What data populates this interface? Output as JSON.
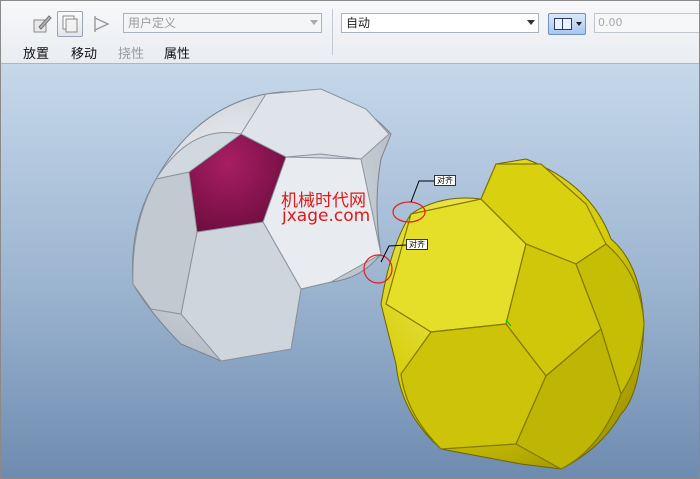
{
  "toolbar": {
    "icons": [
      "sketch-edit-icon",
      "copy-icon",
      "dimension-icon"
    ],
    "user_defined_value": "用户定义",
    "constraint_value": "自动",
    "numeric_value": "0.00",
    "view_button_icon": "split-panel-icon"
  },
  "menu": {
    "items": [
      {
        "label": "放置",
        "enabled": true
      },
      {
        "label": "移动",
        "enabled": true
      },
      {
        "label": "挠性",
        "enabled": false
      },
      {
        "label": "属性",
        "enabled": true
      }
    ]
  },
  "viewport": {
    "watermark_cn": "机械时代网",
    "watermark_url": "jxage.com",
    "tags": [
      "对齐",
      "对齐"
    ],
    "colors": {
      "white_patch": "#dfe4ea",
      "magenta_patch": "#8a1450",
      "yellow_patch": "#d6cc06",
      "highlight_circle": "#e02020"
    }
  }
}
